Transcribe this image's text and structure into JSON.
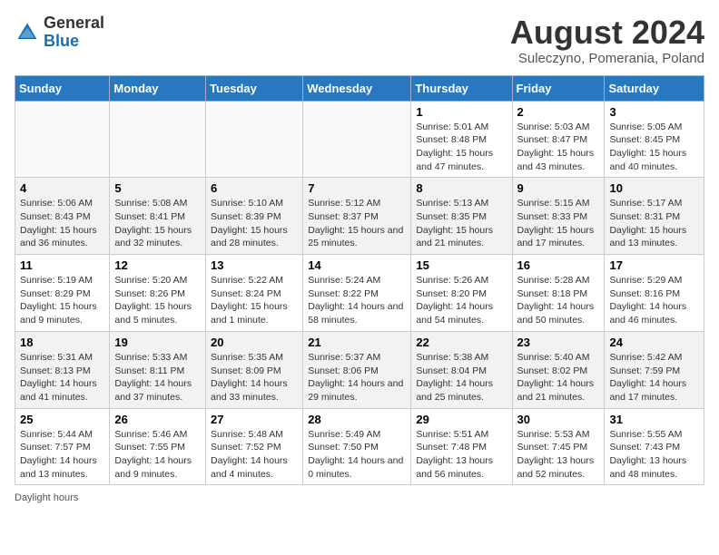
{
  "logo": {
    "general": "General",
    "blue": "Blue"
  },
  "title": "August 2024",
  "subtitle": "Suleczyno, Pomerania, Poland",
  "weekdays": [
    "Sunday",
    "Monday",
    "Tuesday",
    "Wednesday",
    "Thursday",
    "Friday",
    "Saturday"
  ],
  "footer": "Daylight hours",
  "weeks": [
    [
      {
        "day": "",
        "info": ""
      },
      {
        "day": "",
        "info": ""
      },
      {
        "day": "",
        "info": ""
      },
      {
        "day": "",
        "info": ""
      },
      {
        "day": "1",
        "info": "Sunrise: 5:01 AM\nSunset: 8:48 PM\nDaylight: 15 hours and 47 minutes."
      },
      {
        "day": "2",
        "info": "Sunrise: 5:03 AM\nSunset: 8:47 PM\nDaylight: 15 hours and 43 minutes."
      },
      {
        "day": "3",
        "info": "Sunrise: 5:05 AM\nSunset: 8:45 PM\nDaylight: 15 hours and 40 minutes."
      }
    ],
    [
      {
        "day": "4",
        "info": "Sunrise: 5:06 AM\nSunset: 8:43 PM\nDaylight: 15 hours and 36 minutes."
      },
      {
        "day": "5",
        "info": "Sunrise: 5:08 AM\nSunset: 8:41 PM\nDaylight: 15 hours and 32 minutes."
      },
      {
        "day": "6",
        "info": "Sunrise: 5:10 AM\nSunset: 8:39 PM\nDaylight: 15 hours and 28 minutes."
      },
      {
        "day": "7",
        "info": "Sunrise: 5:12 AM\nSunset: 8:37 PM\nDaylight: 15 hours and 25 minutes."
      },
      {
        "day": "8",
        "info": "Sunrise: 5:13 AM\nSunset: 8:35 PM\nDaylight: 15 hours and 21 minutes."
      },
      {
        "day": "9",
        "info": "Sunrise: 5:15 AM\nSunset: 8:33 PM\nDaylight: 15 hours and 17 minutes."
      },
      {
        "day": "10",
        "info": "Sunrise: 5:17 AM\nSunset: 8:31 PM\nDaylight: 15 hours and 13 minutes."
      }
    ],
    [
      {
        "day": "11",
        "info": "Sunrise: 5:19 AM\nSunset: 8:29 PM\nDaylight: 15 hours and 9 minutes."
      },
      {
        "day": "12",
        "info": "Sunrise: 5:20 AM\nSunset: 8:26 PM\nDaylight: 15 hours and 5 minutes."
      },
      {
        "day": "13",
        "info": "Sunrise: 5:22 AM\nSunset: 8:24 PM\nDaylight: 15 hours and 1 minute."
      },
      {
        "day": "14",
        "info": "Sunrise: 5:24 AM\nSunset: 8:22 PM\nDaylight: 14 hours and 58 minutes."
      },
      {
        "day": "15",
        "info": "Sunrise: 5:26 AM\nSunset: 8:20 PM\nDaylight: 14 hours and 54 minutes."
      },
      {
        "day": "16",
        "info": "Sunrise: 5:28 AM\nSunset: 8:18 PM\nDaylight: 14 hours and 50 minutes."
      },
      {
        "day": "17",
        "info": "Sunrise: 5:29 AM\nSunset: 8:16 PM\nDaylight: 14 hours and 46 minutes."
      }
    ],
    [
      {
        "day": "18",
        "info": "Sunrise: 5:31 AM\nSunset: 8:13 PM\nDaylight: 14 hours and 41 minutes."
      },
      {
        "day": "19",
        "info": "Sunrise: 5:33 AM\nSunset: 8:11 PM\nDaylight: 14 hours and 37 minutes."
      },
      {
        "day": "20",
        "info": "Sunrise: 5:35 AM\nSunset: 8:09 PM\nDaylight: 14 hours and 33 minutes."
      },
      {
        "day": "21",
        "info": "Sunrise: 5:37 AM\nSunset: 8:06 PM\nDaylight: 14 hours and 29 minutes."
      },
      {
        "day": "22",
        "info": "Sunrise: 5:38 AM\nSunset: 8:04 PM\nDaylight: 14 hours and 25 minutes."
      },
      {
        "day": "23",
        "info": "Sunrise: 5:40 AM\nSunset: 8:02 PM\nDaylight: 14 hours and 21 minutes."
      },
      {
        "day": "24",
        "info": "Sunrise: 5:42 AM\nSunset: 7:59 PM\nDaylight: 14 hours and 17 minutes."
      }
    ],
    [
      {
        "day": "25",
        "info": "Sunrise: 5:44 AM\nSunset: 7:57 PM\nDaylight: 14 hours and 13 minutes."
      },
      {
        "day": "26",
        "info": "Sunrise: 5:46 AM\nSunset: 7:55 PM\nDaylight: 14 hours and 9 minutes."
      },
      {
        "day": "27",
        "info": "Sunrise: 5:48 AM\nSunset: 7:52 PM\nDaylight: 14 hours and 4 minutes."
      },
      {
        "day": "28",
        "info": "Sunrise: 5:49 AM\nSunset: 7:50 PM\nDaylight: 14 hours and 0 minutes."
      },
      {
        "day": "29",
        "info": "Sunrise: 5:51 AM\nSunset: 7:48 PM\nDaylight: 13 hours and 56 minutes."
      },
      {
        "day": "30",
        "info": "Sunrise: 5:53 AM\nSunset: 7:45 PM\nDaylight: 13 hours and 52 minutes."
      },
      {
        "day": "31",
        "info": "Sunrise: 5:55 AM\nSunset: 7:43 PM\nDaylight: 13 hours and 48 minutes."
      }
    ]
  ]
}
